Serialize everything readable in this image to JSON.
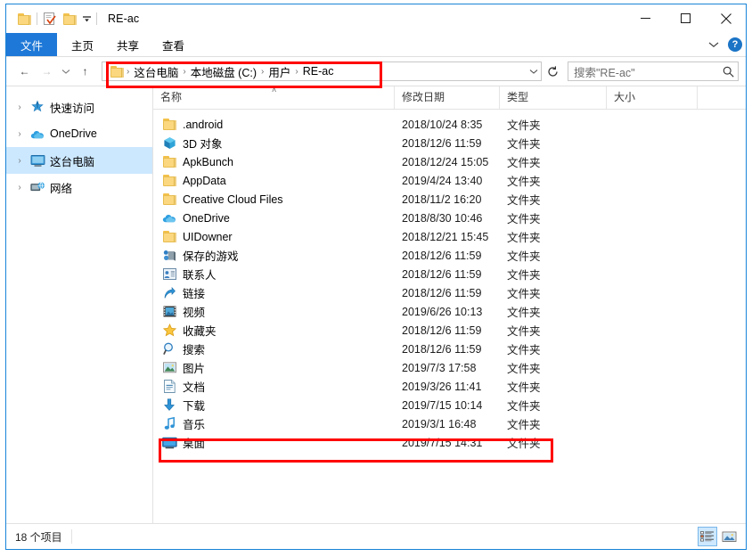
{
  "window": {
    "title": "RE-ac",
    "quick_access": [
      {
        "name": "folder-icon",
        "label": "folder"
      },
      {
        "name": "properties-icon",
        "label": "properties"
      },
      {
        "name": "new-folder-icon",
        "label": "new folder"
      },
      {
        "name": "customize-qat-dropdown",
        "label": "▾"
      }
    ],
    "buttons": {
      "minimize": "─",
      "maximize": "□",
      "close": "✕"
    }
  },
  "ribbon": {
    "tabs": [
      {
        "label": "文件",
        "selected": true
      },
      {
        "label": "主页",
        "selected": false
      },
      {
        "label": "共享",
        "selected": false
      },
      {
        "label": "查看",
        "selected": false
      }
    ],
    "collapse_label": "⌄",
    "help_label": "?"
  },
  "address": {
    "back": "←",
    "forward": "→",
    "recent": "⌄",
    "up": "↑",
    "crumbs": [
      "这台电脑",
      "本地磁盘 (C:)",
      "用户",
      "RE-ac"
    ],
    "separator": "›",
    "dropdown": "⌄",
    "refresh": "↻"
  },
  "search": {
    "placeholder": "搜索\"RE-ac\"",
    "icon": "search-icon"
  },
  "navpane": {
    "items": [
      {
        "label": "快速访问",
        "icon": "pin-star-icon",
        "selected": false
      },
      {
        "label": "OneDrive",
        "icon": "onedrive-cloud-icon",
        "selected": false
      },
      {
        "label": "这台电脑",
        "icon": "this-pc-monitor-icon",
        "selected": true
      },
      {
        "label": "网络",
        "icon": "network-icon",
        "selected": false
      }
    ],
    "chevron": "›"
  },
  "columns": [
    {
      "key": "name",
      "label": "名称"
    },
    {
      "key": "date",
      "label": "修改日期"
    },
    {
      "key": "type",
      "label": "类型"
    },
    {
      "key": "size",
      "label": "大小"
    }
  ],
  "sort_indicator": "˄",
  "files": [
    {
      "name": ".android",
      "icon": "folder-icon",
      "date": "2018/10/24 8:35",
      "type": "文件夹",
      "size": ""
    },
    {
      "name": "3D 对象",
      "icon": "3d-objects-icon",
      "date": "2018/12/6 11:59",
      "type": "文件夹",
      "size": ""
    },
    {
      "name": "ApkBunch",
      "icon": "folder-icon",
      "date": "2018/12/24 15:05",
      "type": "文件夹",
      "size": ""
    },
    {
      "name": "AppData",
      "icon": "folder-icon",
      "date": "2019/4/24 13:40",
      "type": "文件夹",
      "size": ""
    },
    {
      "name": "Creative Cloud Files",
      "icon": "folder-icon",
      "date": "2018/11/2 16:20",
      "type": "文件夹",
      "size": ""
    },
    {
      "name": "OneDrive",
      "icon": "onedrive-cloud-icon",
      "date": "2018/8/30 10:46",
      "type": "文件夹",
      "size": ""
    },
    {
      "name": "UIDowner",
      "icon": "folder-icon",
      "date": "2018/12/21 15:45",
      "type": "文件夹",
      "size": ""
    },
    {
      "name": "保存的游戏",
      "icon": "saved-games-icon",
      "date": "2018/12/6 11:59",
      "type": "文件夹",
      "size": ""
    },
    {
      "name": "联系人",
      "icon": "contacts-icon",
      "date": "2018/12/6 11:59",
      "type": "文件夹",
      "size": ""
    },
    {
      "name": "链接",
      "icon": "links-arrow-icon",
      "date": "2018/12/6 11:59",
      "type": "文件夹",
      "size": ""
    },
    {
      "name": "视频",
      "icon": "videos-film-icon",
      "date": "2019/6/26 10:13",
      "type": "文件夹",
      "size": ""
    },
    {
      "name": "收藏夹",
      "icon": "favorites-star-icon",
      "date": "2018/12/6 11:59",
      "type": "文件夹",
      "size": ""
    },
    {
      "name": "搜索",
      "icon": "searches-magnifier-icon",
      "date": "2018/12/6 11:59",
      "type": "文件夹",
      "size": ""
    },
    {
      "name": "图片",
      "icon": "pictures-icon",
      "date": "2019/7/3 17:58",
      "type": "文件夹",
      "size": ""
    },
    {
      "name": "文档",
      "icon": "documents-icon",
      "date": "2019/3/26 11:41",
      "type": "文件夹",
      "size": ""
    },
    {
      "name": "下载",
      "icon": "downloads-arrow-icon",
      "date": "2019/7/15 10:14",
      "type": "文件夹",
      "size": ""
    },
    {
      "name": "音乐",
      "icon": "music-note-icon",
      "date": "2019/3/1 16:48",
      "type": "文件夹",
      "size": ""
    },
    {
      "name": "桌面",
      "icon": "desktop-icon",
      "date": "2019/7/15 14:31",
      "type": "文件夹",
      "size": ""
    }
  ],
  "statusbar": {
    "item_count": "18 个项目",
    "views": [
      {
        "name": "details-view-button",
        "active": true
      },
      {
        "name": "large-icons-view-button",
        "active": false
      }
    ]
  },
  "annotations": {
    "accent": "#ff0000",
    "boxes": [
      "address-bar-highlight",
      "desktop-row-highlight"
    ]
  },
  "colors": {
    "accent": "#1883d7",
    "ribbon_file_tab": "#1e78d7",
    "selection": "#cce8ff",
    "annotation": "#ff0000"
  }
}
